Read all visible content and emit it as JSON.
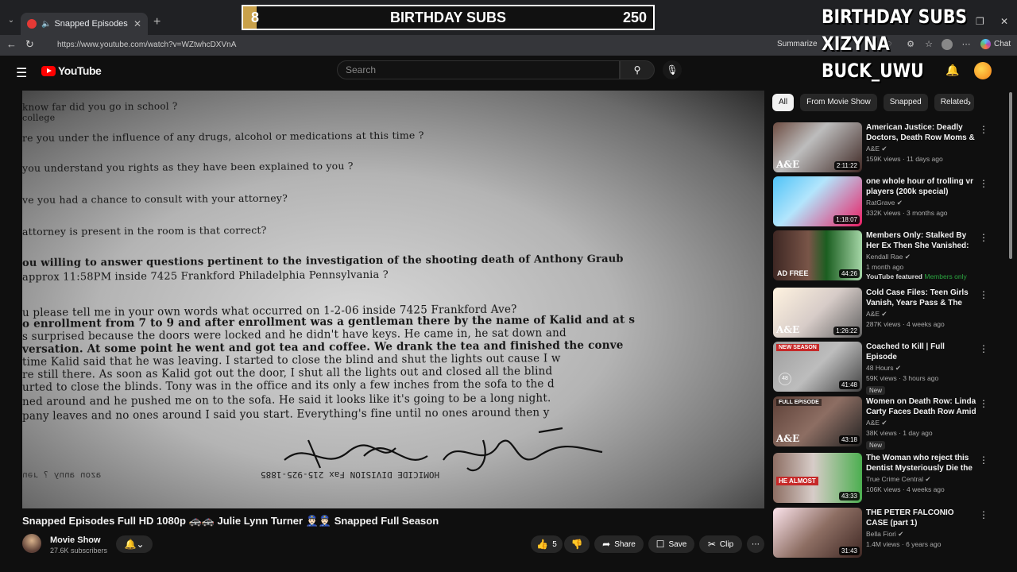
{
  "browser": {
    "tab_title": "Snapped Episodes Full HD 10...",
    "url": "https://www.youtube.com/watch?v=WZtwhcDXVnA",
    "summarize_label": "Summarize",
    "chat_label": "Chat"
  },
  "overlay": {
    "counter_current": "8",
    "counter_label": "BIRTHDAY SUBS",
    "counter_goal": "250",
    "counter_progress": 0.032,
    "list": [
      "BIRTHDAY SUBS",
      "XIZYNA",
      "BUCK_UWU"
    ]
  },
  "youtube": {
    "logo_text": "YouTube",
    "search_placeholder": "Search"
  },
  "video": {
    "doc_lines": [
      "know far did you go in school ?",
      "college",
      "re you under the influence of any drugs, alcohol or medications at this time ?",
      "you understand you rights as they have been explained to you ?",
      "ve you had a chance to consult with your attorney?",
      "attorney is present in the room is that correct?",
      "ou willing to answer questions pertinent to the investigation of the shooting death of Anthony Graub",
      " approx 11:58PM inside 7425 Frankford Philadelphia Pennsylvania ?",
      "u please tell me in your own words what occurred on 1-2-06 inside 7425 Frankford Ave?",
      "o enrollment from 7 to 9 and after enrollment was a gentleman there by the name of Kalid and at s",
      "s surprised because the doors were locked and he didn't have keys. He came in, he sat down and",
      "versation. At some point he went and got tea and coffee. We drank the tea and finished the conve",
      " time Kalid said that he was leaving. I started to close the blind and shut the lights out cause I w",
      "re still there. As soon as Kalid got out the door, I shut all the lights out and closed all the blind",
      "urted to close the blinds. Tony was in the office and its only a few inches from the sofa to the d",
      "ned around and he pushed me on to the sofa. He said it looks like it's going to be a long night.",
      "pany leaves and no ones around I said you start. Everything's fine until no ones around then y"
    ],
    "signature": "Karen Graubert",
    "footer_fax": "HOMICIDE DIVISION   Fax 215-925-1885",
    "footer_left": "uer   ¿ ʎuuɐ uozɐ",
    "title": "Snapped Episodes Full HD 1080p 🚓🚓 Julie Lynn Turner 👮🏻‍♂️👮🏻‍♂️ Snapped Full Season",
    "channel_name": "Movie Show",
    "channel_subs": "27.6K subscribers",
    "likes": "5",
    "share_label": "Share",
    "save_label": "Save",
    "clip_label": "Clip"
  },
  "sidebar": {
    "chips": [
      "All",
      "From Movie Show",
      "Snapped",
      "Related"
    ],
    "recs": [
      {
        "title": "American Justice: Deadly Doctors, Death Row Moms & a...",
        "channel": "A&E",
        "meta": "159K views · 11 days ago",
        "duration": "2:11:22",
        "brand": "A&E"
      },
      {
        "title": "one whole hour of trolling vr players (200k special)",
        "channel": "RatGrave",
        "meta": "332K views · 3 months ago",
        "duration": "1:18:07"
      },
      {
        "title": "Members Only: Stalked By Her Ex Then She Vanished: Where ...",
        "channel": "Kendall Rae",
        "meta": "1 month ago",
        "featured": "YouTube featured",
        "members": "Members only",
        "duration": "44:26",
        "adfree": "AD FREE"
      },
      {
        "title": "Cold Case Files: Teen Girls Vanish, Years Pass & The Kille...",
        "channel": "A&E",
        "meta": "287K views · 4 weeks ago",
        "duration": "1:26:22",
        "brand": "A&E"
      },
      {
        "title": "Coached to Kill | Full Episode",
        "channel": "48 Hours",
        "meta": "59K views · 3 hours ago",
        "duration": "41:48",
        "tag": "NEW SEASON",
        "new": "New",
        "age": "48"
      },
      {
        "title": "Women on Death Row: Linda Carty Faces Death Row Amid ...",
        "channel": "A&E",
        "meta": "38K views · 1 day ago",
        "duration": "43:18",
        "tag": "FULL EPISODE",
        "new": "New",
        "brand": "A&E"
      },
      {
        "title": "The Woman who reject this Dentist Mysteriously Die the ...",
        "channel": "True Crime Central",
        "meta": "106K views · 4 weeks ago",
        "duration": "43:33",
        "thumb_text": "HE ALMOST"
      },
      {
        "title": "THE PETER FALCONIO CASE (part 1)",
        "channel": "Bella Fiori",
        "meta": "1.4M views · 6 years ago",
        "duration": "31:43"
      }
    ]
  }
}
